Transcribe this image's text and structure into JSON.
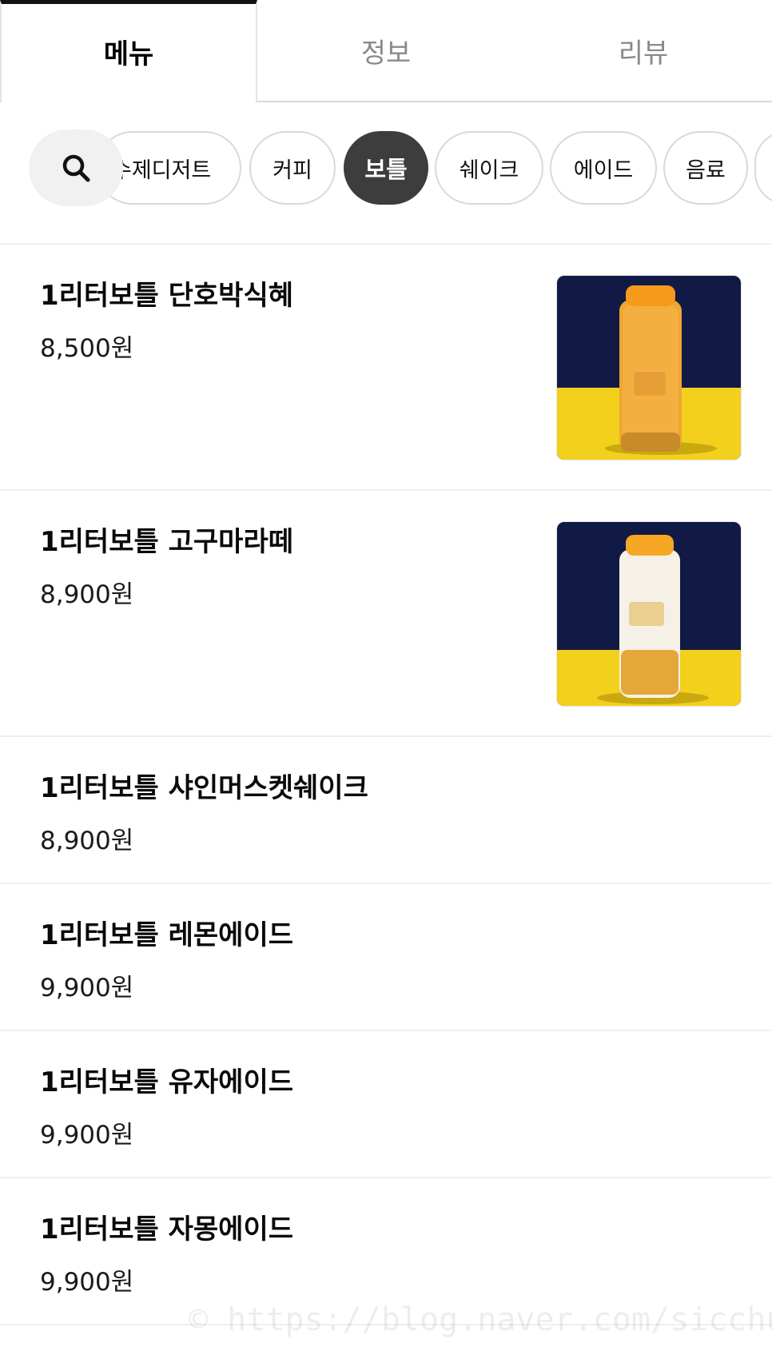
{
  "tabs": [
    {
      "label": "메뉴",
      "active": true
    },
    {
      "label": "정보",
      "active": false
    },
    {
      "label": "리뷰",
      "active": false
    }
  ],
  "search": {
    "icon": "search-icon"
  },
  "chips": [
    {
      "label": "수제디저트",
      "active": false
    },
    {
      "label": "커피",
      "active": false
    },
    {
      "label": "보틀",
      "active": true
    },
    {
      "label": "쉐이크",
      "active": false
    },
    {
      "label": "에이드",
      "active": false
    },
    {
      "label": "음료",
      "active": false
    }
  ],
  "menu": {
    "items": [
      {
        "name": "1리터보틀 단호박식혜",
        "price": "8,500원",
        "image": "pumpkin-sikhye-bottle"
      },
      {
        "name": "1리터보틀 고구마라떼",
        "price": "8,900원",
        "image": "sweet-potato-latte-bottle"
      },
      {
        "name": "1리터보틀 샤인머스켓쉐이크",
        "price": "8,900원"
      },
      {
        "name": "1리터보틀 레몬에이드",
        "price": "9,900원"
      },
      {
        "name": "1리터보틀 유자에이드",
        "price": "9,900원"
      },
      {
        "name": "1리터보틀 자몽에이드",
        "price": "9,900원"
      }
    ]
  },
  "watermark": "© https://blog.naver.com/sicchungel",
  "colors": {
    "active_chip": "#3d3d3d",
    "photo_background": "#111a45",
    "photo_table": "#f2d01c",
    "bottle_cap": "#f5a623"
  }
}
